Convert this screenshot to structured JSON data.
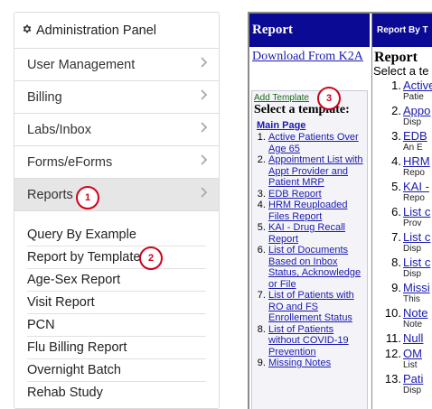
{
  "panel": {
    "title": "Administration Panel",
    "items": [
      {
        "label": "User Management"
      },
      {
        "label": "Billing"
      },
      {
        "label": "Labs/Inbox"
      },
      {
        "label": "Forms/eForms"
      },
      {
        "label": "Reports"
      }
    ],
    "subitems": [
      "Query By Example",
      "Report by Template",
      "Age-Sex Report",
      "Visit Report",
      "PCN",
      "Flu Billing Report",
      "Overnight Batch",
      "Rehab Study"
    ]
  },
  "badges": [
    "1",
    "2",
    "3"
  ],
  "report": {
    "header": "Report",
    "download": "Download From K2A",
    "add_template": "Add Template",
    "select_template": "Select a template:",
    "main_page": "Main Page",
    "templates": [
      "Active Patients Over Age 65",
      "Appointment List with Appt Provider and Patient MRP",
      "EDB Report",
      "HRM Reuploaded Files Report",
      "KAI - Drug Recall Report",
      "List of Documents Based on Inbox Status, Acknowledge or File",
      "List of Patients with RO and FS Enrollement Status",
      "List of Patients without COVID-19 Prevention",
      "Missing Notes"
    ]
  },
  "right_panel": {
    "header": "Report By T",
    "title": "Report",
    "subtitle": "Select a te",
    "rows": [
      {
        "num": "1.",
        "title": "Active",
        "desc": "Patie"
      },
      {
        "num": "2.",
        "title": "Appo",
        "desc": "Disp"
      },
      {
        "num": "3.",
        "title": "EDB",
        "desc": "An E"
      },
      {
        "num": "4.",
        "title": "HRM",
        "desc": "Repo"
      },
      {
        "num": "5.",
        "title": "KAI -",
        "desc": "Repo"
      },
      {
        "num": "6.",
        "title": "List c",
        "desc": "Prov"
      },
      {
        "num": "7.",
        "title": "List c",
        "desc": "Disp"
      },
      {
        "num": "8.",
        "title": "List c",
        "desc": "Disp"
      },
      {
        "num": "9.",
        "title": "Missi",
        "desc": "This"
      },
      {
        "num": "10.",
        "title": "Note",
        "desc": "Note"
      },
      {
        "num": "11.",
        "title": "Null",
        "desc": ""
      },
      {
        "num": "12.",
        "title": "OM",
        "desc": "List"
      },
      {
        "num": "13.",
        "title": "Pati",
        "desc": "Disp"
      }
    ]
  }
}
